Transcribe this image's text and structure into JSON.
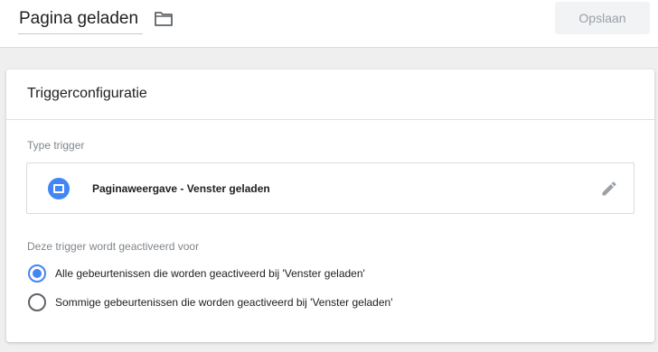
{
  "header": {
    "title": "Pagina geladen",
    "save_label": "Opslaan"
  },
  "card": {
    "title": "Triggerconfiguratie",
    "type_label": "Type trigger",
    "trigger_type": {
      "icon": "window-icon",
      "name": "Paginaweergave - Venster geladen"
    },
    "fires_on_label": "Deze trigger wordt geactiveerd voor",
    "options": [
      {
        "label": "Alle gebeurtenissen die worden geactiveerd bij 'Venster geladen'",
        "checked": true
      },
      {
        "label": "Sommige gebeurtenissen die worden geactiveerd bij 'Venster geladen'",
        "checked": false
      }
    ]
  },
  "colors": {
    "accent": "#4285f4",
    "background": "#efefef"
  }
}
